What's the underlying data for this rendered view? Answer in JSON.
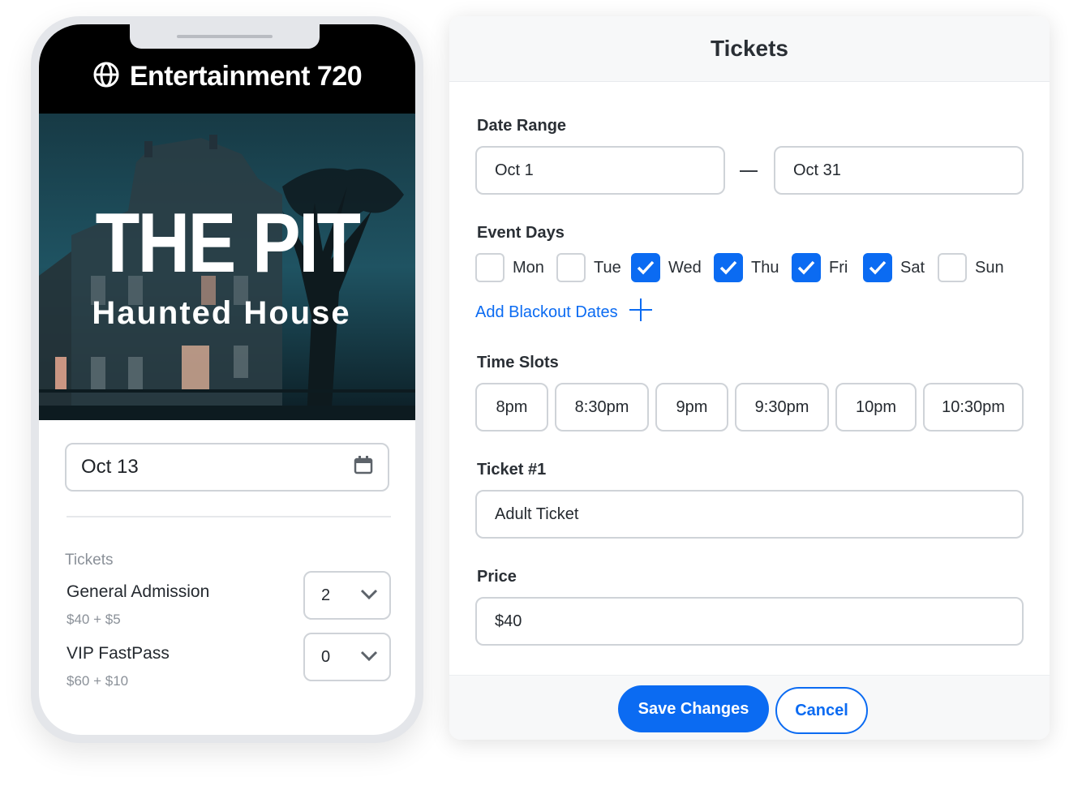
{
  "phone": {
    "brand": "Entertainment 720",
    "hero": {
      "title": "THE PIT",
      "subtitle": "Haunted House"
    },
    "date_value": "Oct 13",
    "tickets_heading": "Tickets",
    "tickets": [
      {
        "name": "General Admission",
        "price": "$40 + $5",
        "quantity": "2"
      },
      {
        "name": "VIP FastPass",
        "price": "$60 + $10",
        "quantity": "0"
      }
    ]
  },
  "panel": {
    "title": "Tickets",
    "date_range": {
      "label": "Date Range",
      "start": "Oct 1",
      "end": "Oct 31"
    },
    "event_days": {
      "label": "Event Days",
      "days": [
        {
          "name": "Mon",
          "checked": false
        },
        {
          "name": "Tue",
          "checked": false
        },
        {
          "name": "Wed",
          "checked": true
        },
        {
          "name": "Thu",
          "checked": true
        },
        {
          "name": "Fri",
          "checked": true
        },
        {
          "name": "Sat",
          "checked": true
        },
        {
          "name": "Sun",
          "checked": false
        }
      ]
    },
    "blackout_link": "Add Blackout Dates",
    "time_slots": {
      "label": "Time Slots",
      "slots": [
        "8pm",
        "8:30pm",
        "9pm",
        "9:30pm",
        "10pm",
        "10:30pm"
      ]
    },
    "ticket": {
      "label": "Ticket #1",
      "value": "Adult Ticket"
    },
    "price": {
      "label": "Price",
      "value": "$40"
    },
    "save_label": "Save Changes",
    "cancel_label": "Cancel"
  },
  "colors": {
    "accent": "#0b6bf2",
    "border": "#cfd3d8",
    "header_bg": "#000000"
  },
  "icons": [
    "globe-icon",
    "calendar-icon",
    "chevron-down-icon",
    "checkmark-icon",
    "plus-icon"
  ]
}
